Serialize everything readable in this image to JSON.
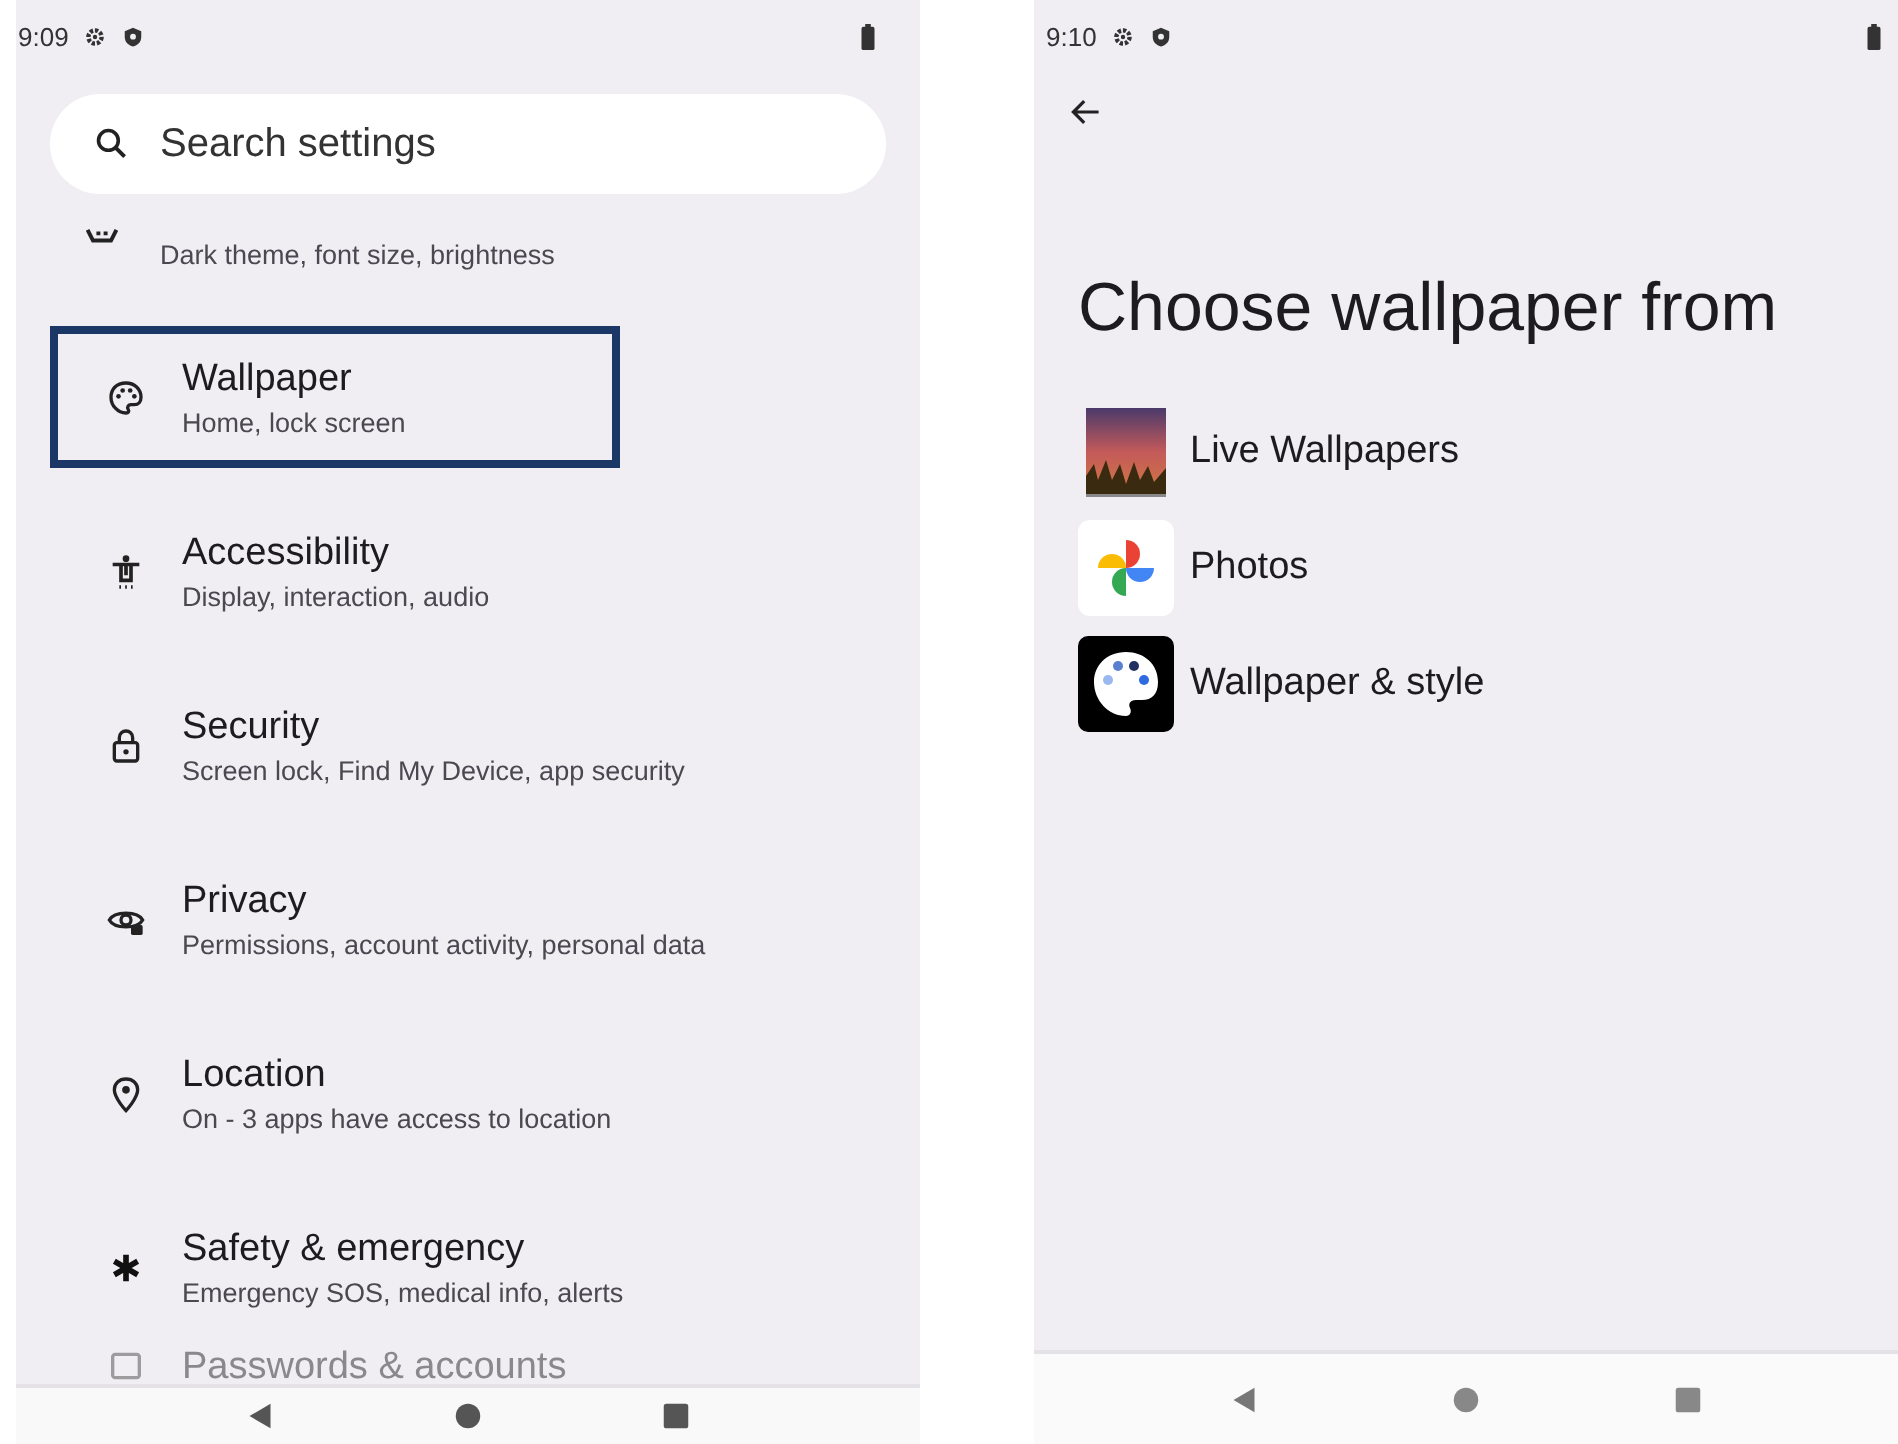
{
  "settings_screen": {
    "status_time": "9:09",
    "search": {
      "placeholder": "Search settings"
    },
    "clipped_top_item": {
      "subtitle": "Dark theme, font size, brightness"
    },
    "items": [
      {
        "kind": "palette",
        "title": "Wallpaper",
        "subtitle": "Home, lock screen",
        "highlighted": true
      },
      {
        "kind": "accessibility",
        "title": "Accessibility",
        "subtitle": "Display, interaction, audio",
        "highlighted": false
      },
      {
        "kind": "lock",
        "title": "Security",
        "subtitle": "Screen lock, Find My Device, app security",
        "highlighted": false
      },
      {
        "kind": "eye",
        "title": "Privacy",
        "subtitle": "Permissions, account activity, personal data",
        "highlighted": false
      },
      {
        "kind": "pin",
        "title": "Location",
        "subtitle": "On - 3 apps have access to location",
        "highlighted": false
      },
      {
        "kind": "asterisk",
        "title": "Safety & emergency",
        "subtitle": "Emergency SOS, medical info, alerts",
        "highlighted": false
      }
    ],
    "clipped_bottom_item": {
      "title": "Passwords & accounts"
    }
  },
  "picker_screen": {
    "status_time": "9:10",
    "heading": "Choose wallpaper from",
    "options": [
      {
        "kind": "live",
        "label": "Live Wallpapers"
      },
      {
        "kind": "photos",
        "label": "Photos"
      },
      {
        "kind": "style",
        "label": "Wallpaper & style"
      }
    ]
  }
}
